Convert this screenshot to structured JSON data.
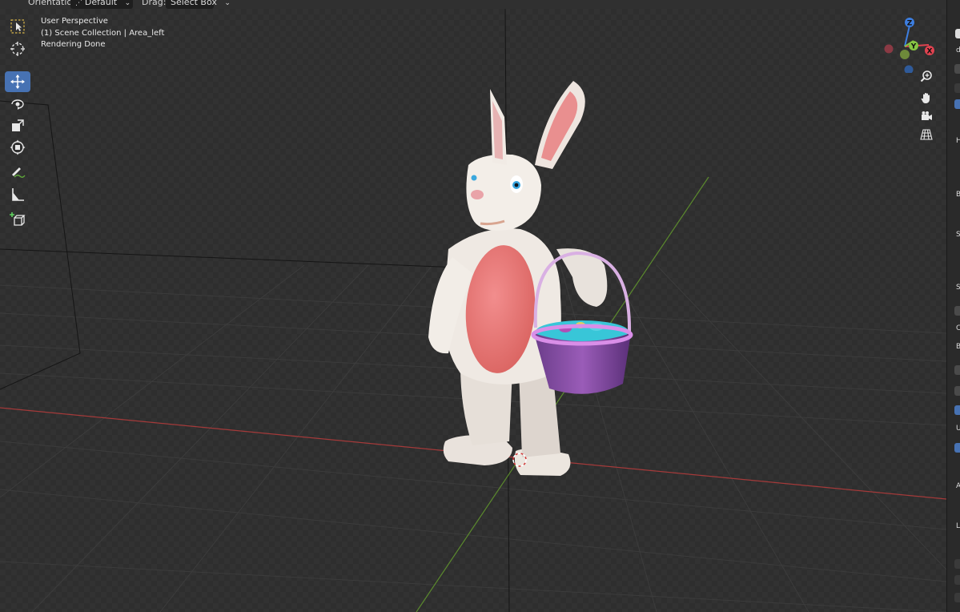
{
  "header": {
    "orientation_label": "Orientation:",
    "orientation_value": "Default",
    "drag_label": "Drag:",
    "drag_value": "Select Box"
  },
  "viewport": {
    "overlay": {
      "line1": "User Perspective",
      "line2": "(1) Scene Collection | Area_left",
      "line3": "Rendering Done"
    },
    "tools": [
      {
        "name": "select-box-icon",
        "active": false
      },
      {
        "name": "cursor-icon",
        "active": false
      },
      {
        "name": "move-icon",
        "active": true
      },
      {
        "name": "rotate-icon",
        "active": false
      },
      {
        "name": "scale-icon",
        "active": false
      },
      {
        "name": "transform-icon",
        "active": false
      },
      {
        "name": "annotate-icon",
        "active": false
      },
      {
        "name": "measure-icon",
        "active": false
      },
      {
        "name": "add-cube-icon",
        "active": false
      }
    ],
    "gizmo": {
      "z": "Z",
      "y": "Y",
      "x": "X"
    },
    "nav_buttons": [
      "zoom-icon",
      "hand-pan-icon",
      "camera-icon",
      "ortho-grid-icon"
    ],
    "colors": {
      "x_axis": "#e04350",
      "y_axis": "#87c443",
      "z_axis": "#3d7ee0",
      "active_tool": "#4772b3"
    }
  },
  "sidepanel": {
    "letters": [
      "d",
      "H",
      "B",
      "S",
      "S",
      "C",
      "B",
      "U",
      "A",
      "L"
    ]
  }
}
